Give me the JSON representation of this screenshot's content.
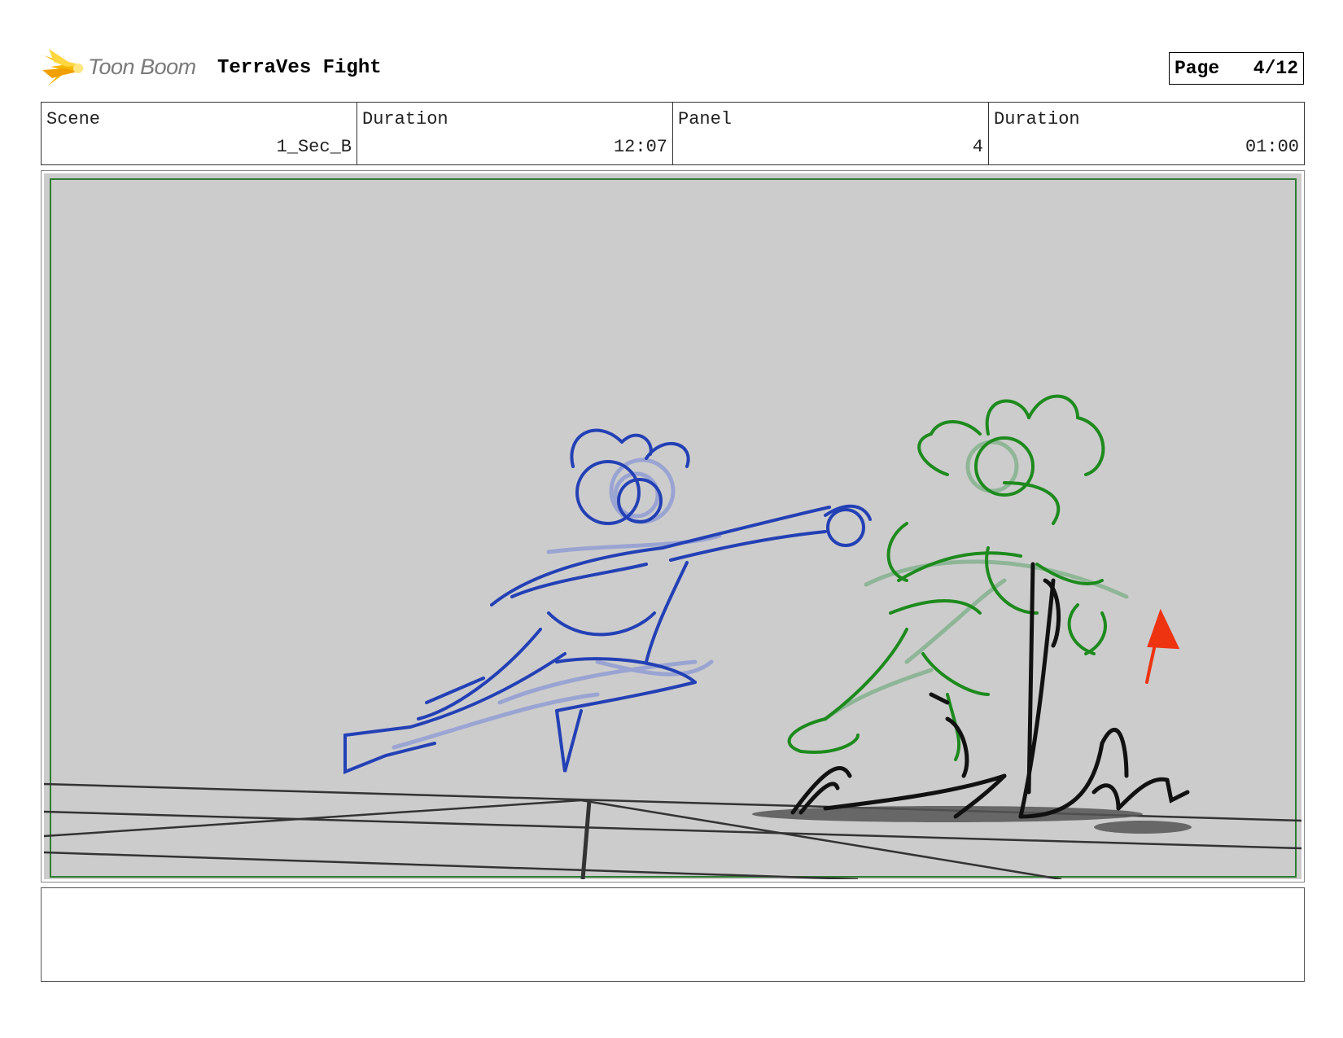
{
  "header": {
    "logo_text": "Toon Boom",
    "title": "TerraVes Fight",
    "page_label": "Page",
    "page_value": "4/12"
  },
  "info": {
    "scene_label": "Scene",
    "scene_value": "1_Sec_B",
    "scene_duration_label": "Duration",
    "scene_duration_value": "12:07",
    "panel_label": "Panel",
    "panel_value": "4",
    "panel_duration_label": "Duration",
    "panel_duration_value": "01:00"
  },
  "panel": {
    "background_color": "#cccccc",
    "safe_frame_color": "#2e7d32",
    "character_left_color": "#2340b5",
    "character_right_color": "#1e8a1e",
    "ground_color": "#111111",
    "motion_arrow_color": "#ee3311"
  },
  "notes": {
    "text": ""
  }
}
